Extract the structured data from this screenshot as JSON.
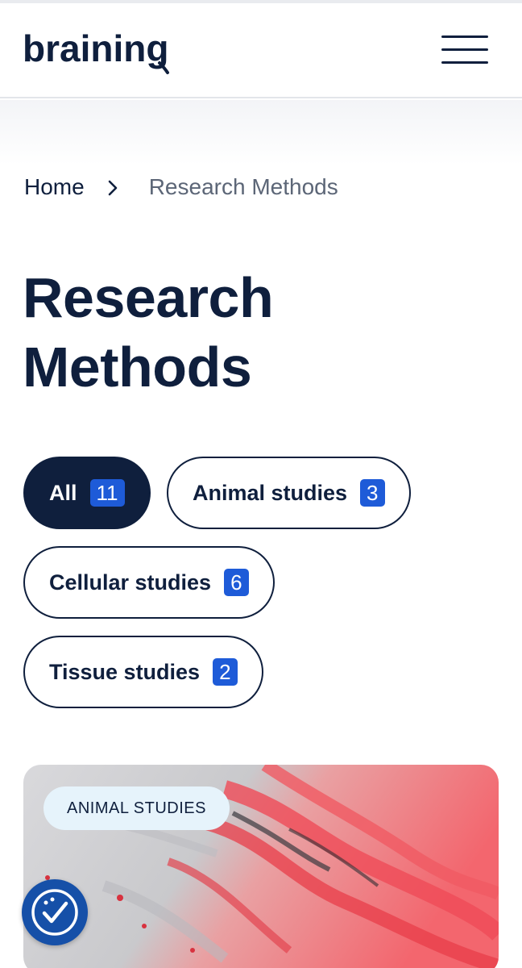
{
  "header": {
    "logo_text": "braining",
    "menu_icon": "hamburger-menu-icon"
  },
  "breadcrumb": {
    "home": "Home",
    "separator_icon": "chevron-right-icon",
    "current": "Research Methods"
  },
  "page": {
    "title_line1": "Research",
    "title_line2": "Methods"
  },
  "filters": [
    {
      "label": "All",
      "count": "11",
      "active": true
    },
    {
      "label": "Animal studies",
      "count": "3",
      "active": false
    },
    {
      "label": "Cellular studies",
      "count": "6",
      "active": false
    },
    {
      "label": "Tissue studies",
      "count": "2",
      "active": false
    }
  ],
  "card": {
    "tag": "ANIMAL STUDIES",
    "image": "marbled-red-grey-abstract-image"
  },
  "accessibility": {
    "icon": "accessibility-check-icon"
  },
  "colors": {
    "navy": "#0f1f3d",
    "badge_blue": "#1e5bd8",
    "tag_bg": "#e6f3fb",
    "a11y_blue": "#1650a8"
  }
}
